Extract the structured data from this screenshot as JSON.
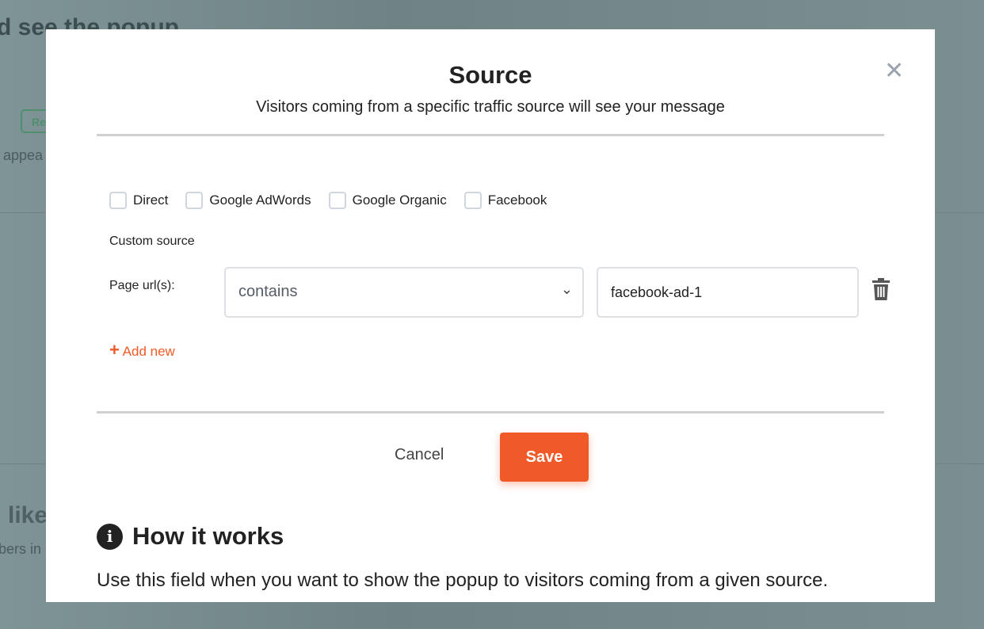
{
  "background": {
    "heading_fragment": "d see the popup",
    "badge_fragment": "Re",
    "text_fragment": "appea",
    "heading2_fragment": "like",
    "text2_fragment": "bers in"
  },
  "modal": {
    "title": "Source",
    "subtitle": "Visitors coming from a specific traffic source will see your message",
    "close_icon": "close-icon",
    "sources": [
      {
        "label": "Direct",
        "checked": false
      },
      {
        "label": "Google AdWords",
        "checked": false
      },
      {
        "label": "Google Organic",
        "checked": false
      },
      {
        "label": "Facebook",
        "checked": false
      }
    ],
    "custom_source_label": "Custom source",
    "page_url_label": "Page url(s):",
    "match_select": {
      "value": "contains"
    },
    "url_input": {
      "value": "facebook-ad-1"
    },
    "add_new_label": "Add new",
    "cancel_label": "Cancel",
    "save_label": "Save",
    "how_title": "How it works",
    "how_text": "Use this field when you want to show the popup to visitors coming from a given source."
  },
  "colors": {
    "accent": "#f05a28",
    "overlay": "#7d9193"
  }
}
